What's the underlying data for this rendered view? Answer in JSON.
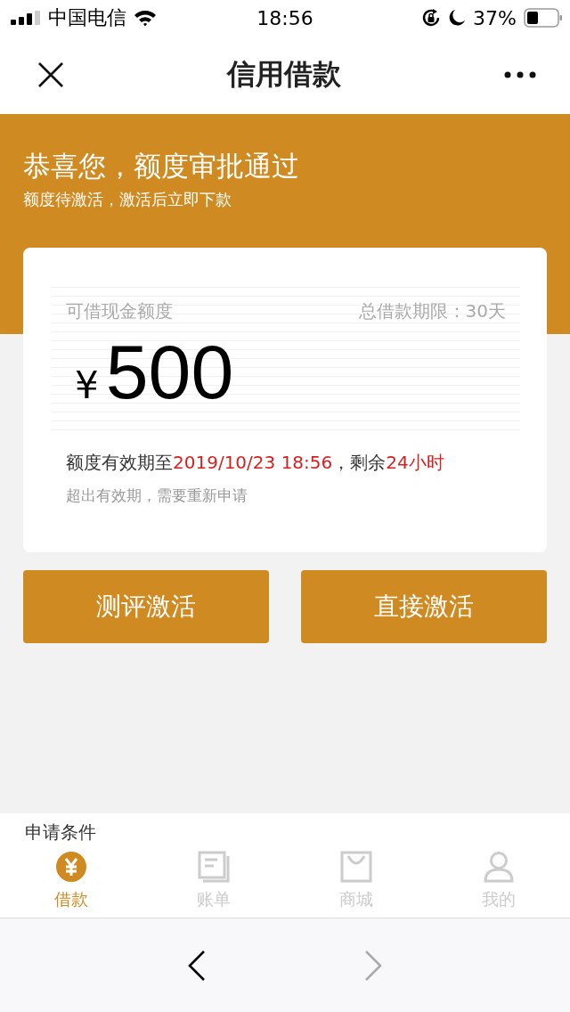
{
  "status_bar": {
    "carrier": "中国电信",
    "time": "18:56",
    "battery": "37%"
  },
  "nav": {
    "title": "信用借款"
  },
  "banner": {
    "title": "恭喜您，额度审批通过",
    "subtitle": "额度待激活，激活后立即下款"
  },
  "card": {
    "label": "可借现金额度",
    "term": "总借款期限：30天",
    "currency": "¥",
    "amount": "500",
    "validity": [
      {
        "text": "额度有效期至",
        "highlight": false
      },
      {
        "text": "2019/10/23 18:56",
        "highlight": true
      },
      {
        "text": "，剩余",
        "highlight": false
      },
      {
        "text": "24小时",
        "highlight": true
      }
    ],
    "note": "超出有效期，需要重新申请"
  },
  "buttons": [
    "测评激活",
    "直接激活"
  ],
  "section": {
    "title": "申请条件"
  },
  "tabs": [
    {
      "label": "借款",
      "kind": "loan",
      "selected": true
    },
    {
      "label": "账单",
      "kind": "bill",
      "selected": false
    },
    {
      "label": "商城",
      "kind": "shop",
      "selected": false
    },
    {
      "label": "我的",
      "kind": "me",
      "selected": false
    }
  ],
  "browser_bar": {
    "back_enabled": true,
    "forward_enabled": false
  }
}
